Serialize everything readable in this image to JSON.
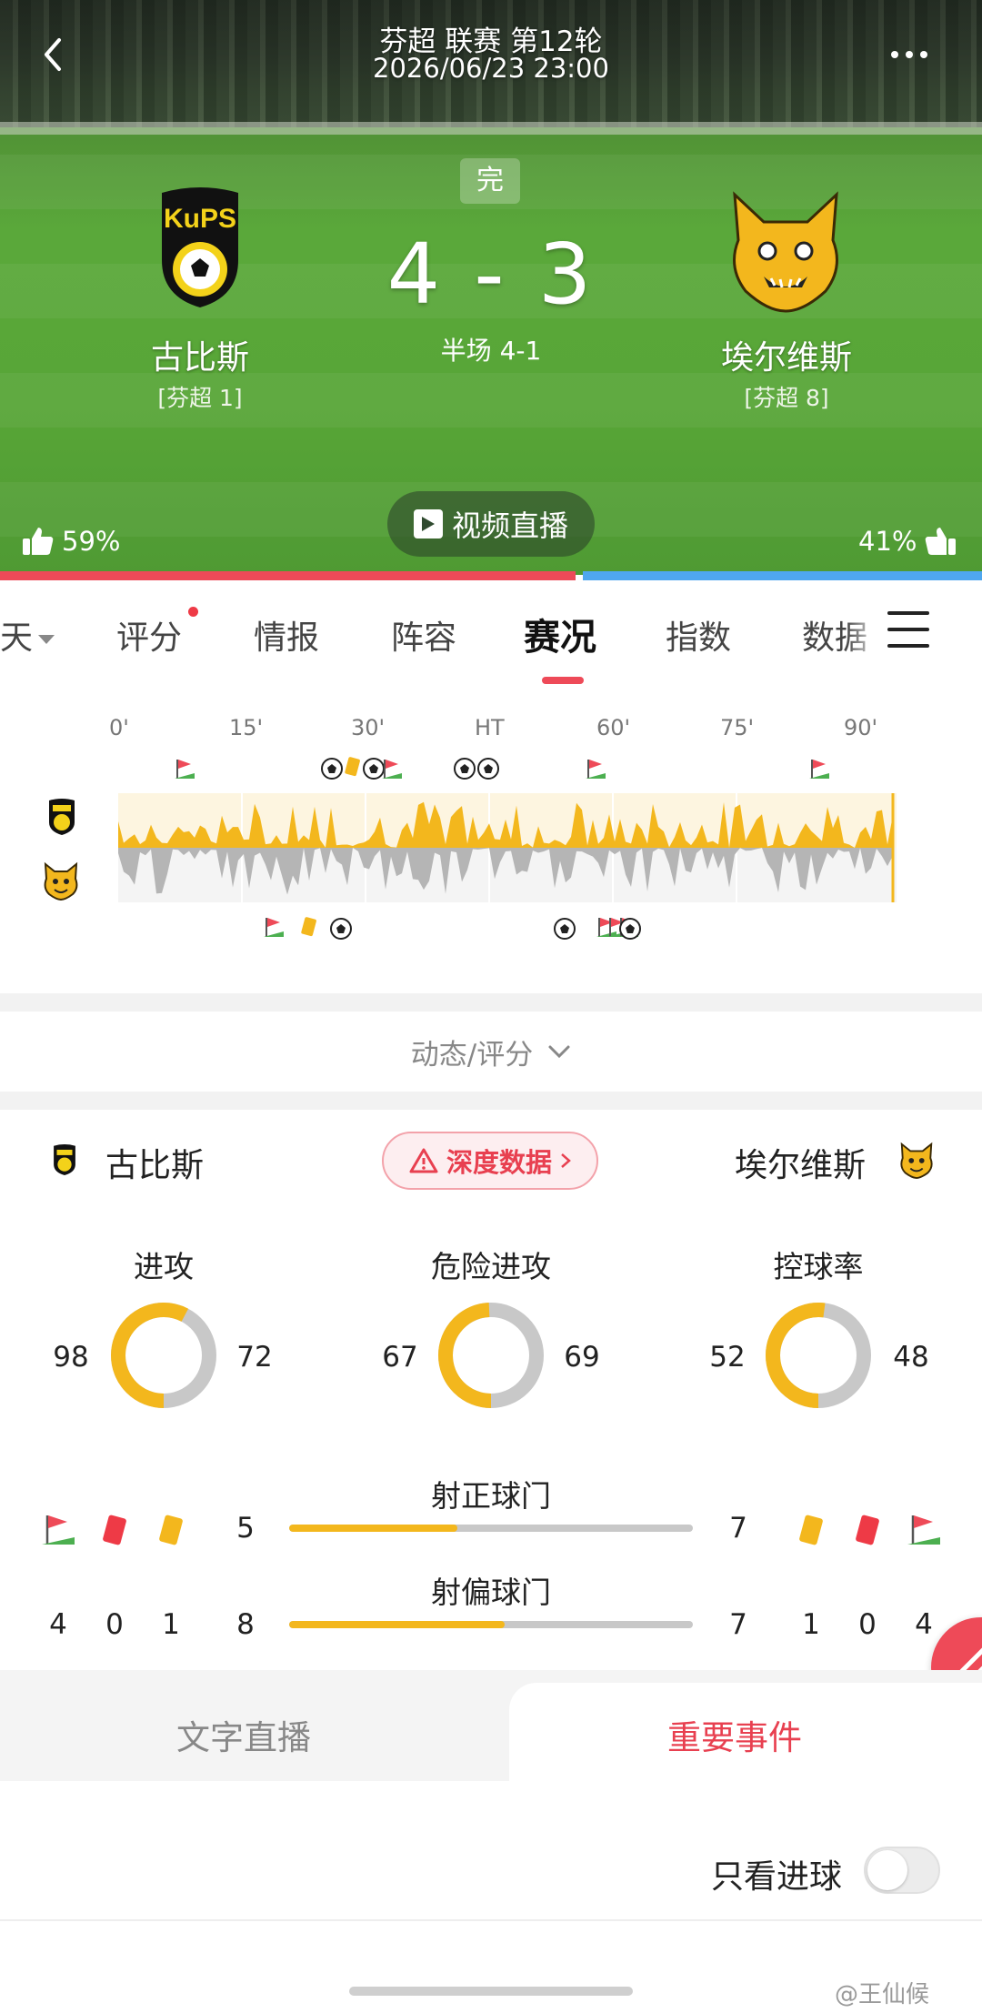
{
  "header": {
    "league_round": "芬超 联赛 第12轮",
    "datetime": "2026/06/23 23:00",
    "status": "完",
    "score": "4 - 3",
    "halftime": "半场 4-1",
    "live_button": "视频直播"
  },
  "home": {
    "name": "古比斯",
    "rank": "[芬超 1]",
    "logo_text": "KuPS",
    "vote": "59%",
    "vote_fraction": 0.59,
    "color": "#ee4a58"
  },
  "away": {
    "name": "埃尔维斯",
    "rank": "[芬超 8]",
    "vote": "41%",
    "vote_fraction": 0.41,
    "color": "#4fa7ef"
  },
  "tabs": {
    "partial": "天",
    "items": [
      "评分",
      "情报",
      "阵容",
      "赛况",
      "指数",
      "数据"
    ],
    "active": "赛况"
  },
  "timeline": {
    "ticks": [
      "0'",
      "15'",
      "30'",
      "HT",
      "60'",
      "75'",
      "90'"
    ],
    "home_color": "#f3b71d",
    "away_color": "#b5b5b5"
  },
  "dynamic_toggle": "动态/评分",
  "stats": {
    "home_name": "古比斯",
    "away_name": "埃尔维斯",
    "deep_data": "深度数据",
    "gauges": [
      {
        "title": "进攻",
        "home": "98",
        "away": "72",
        "home_val": 98,
        "away_val": 72
      },
      {
        "title": "危险进攻",
        "home": "67",
        "away": "69",
        "home_val": 67,
        "away_val": 69
      },
      {
        "title": "控球率",
        "home": "52",
        "away": "48",
        "home_val": 52,
        "away_val": 48
      }
    ],
    "bars": [
      {
        "title": "射正球门",
        "home": "5",
        "away": "7",
        "home_val": 5,
        "away_val": 7
      },
      {
        "title": "射偏球门",
        "home": "8",
        "away": "7",
        "home_val": 8,
        "away_val": 7
      }
    ],
    "home_counts": {
      "corners": "4",
      "red": "0",
      "yellow": "1"
    },
    "away_counts": {
      "yellow": "1",
      "red": "0",
      "corners": "4"
    },
    "accent_color": "#f3b71d",
    "track_color": "#c8c8c8"
  },
  "bottom_tabs": {
    "text_live": "文字直播",
    "key_events": "重要事件"
  },
  "goals_only_label": "只看进球",
  "goals_only_on": false,
  "watermark": "@王仙候"
}
